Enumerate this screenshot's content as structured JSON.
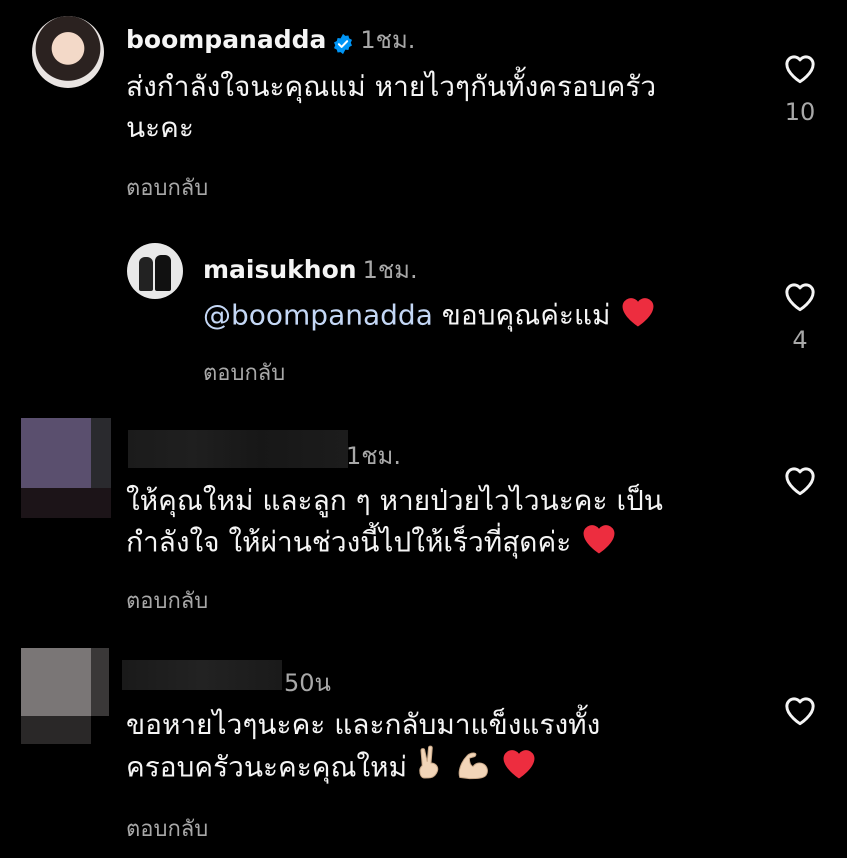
{
  "comments": [
    {
      "username": "boompanadda",
      "verified": true,
      "time": "1ชม.",
      "text_line1": "ส่งกำลังใจนะคุณแม่ หายไวๆกันทั้งครอบครัว",
      "text_line2": "นะคะ",
      "reply_label": "ตอบกลับ",
      "like_count": "10"
    },
    {
      "username": "maisukhon",
      "time": "1ชม.",
      "mention": "@boompanadda",
      "text": "ขอบคุณค่ะแม่",
      "reply_label": "ตอบกลับ",
      "like_count": "4"
    },
    {
      "time": "1ชม.",
      "text_line1": "ให้คุณใหม่ และลูก ๆ หายป่วยไวไวนะคะ เป็น",
      "text_line2": "กำลังใจ ให้ผ่านช่วงนี้ไปให้เร็วที่สุดค่ะ",
      "reply_label": "ตอบกลับ"
    },
    {
      "time": "50น",
      "text_line1": "ขอหายไวๆนะคะ และกลับมาแข็งแรงทั้ง",
      "text_line2": "ครอบครัวนะคะคุณใหม่",
      "reply_label": "ตอบกลับ"
    }
  ],
  "icons": {
    "like": "heart-outline-icon",
    "verified": "verified-badge-icon",
    "heart_emoji": "red-heart-emoji",
    "peace_emoji": "victory-hand-emoji",
    "muscle_emoji": "flexed-biceps-emoji"
  },
  "colors": {
    "background": "#000000",
    "verified": "#0095f6",
    "heart": "#ed2d3f",
    "secondary_text": "#a8a8a8",
    "mention": "#c4d7f5"
  }
}
